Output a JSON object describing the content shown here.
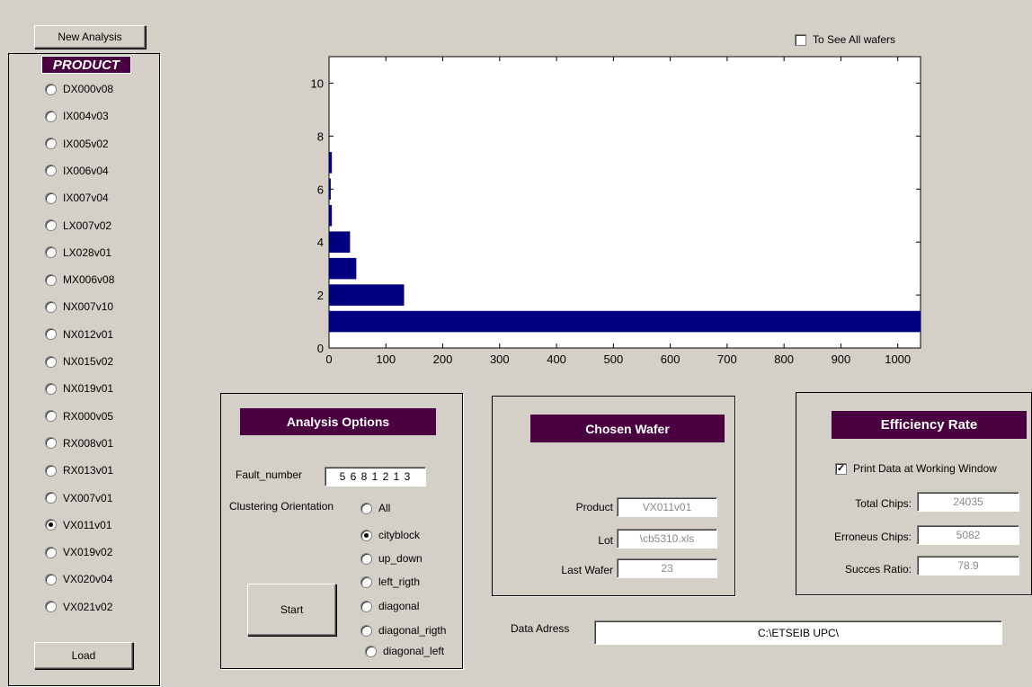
{
  "buttons": {
    "new_analysis": "New Analysis",
    "load": "Load",
    "start": "Start"
  },
  "product": {
    "title": "PRODUCT",
    "items": [
      {
        "label": "DX000v08",
        "selected": false
      },
      {
        "label": "IX004v03",
        "selected": false
      },
      {
        "label": "IX005v02",
        "selected": false
      },
      {
        "label": "IX006v04",
        "selected": false
      },
      {
        "label": "IX007v04",
        "selected": false
      },
      {
        "label": "LX007v02",
        "selected": false
      },
      {
        "label": "LX028v01",
        "selected": false
      },
      {
        "label": "MX006v08",
        "selected": false
      },
      {
        "label": "NX007v10",
        "selected": false
      },
      {
        "label": "NX012v01",
        "selected": false
      },
      {
        "label": "NX015v02",
        "selected": false
      },
      {
        "label": "NX019v01",
        "selected": false
      },
      {
        "label": "RX000v05",
        "selected": false
      },
      {
        "label": "RX008v01",
        "selected": false
      },
      {
        "label": "RX013v01",
        "selected": false
      },
      {
        "label": "VX007v01",
        "selected": false
      },
      {
        "label": "VX011v01",
        "selected": true
      },
      {
        "label": "VX019v02",
        "selected": false
      },
      {
        "label": "VX020v04",
        "selected": false
      },
      {
        "label": "VX021v02",
        "selected": false
      }
    ]
  },
  "see_all": {
    "label": "To See All wafers",
    "checked": false
  },
  "analysis": {
    "title": "Analysis Options",
    "fault_label": "Fault_number",
    "fault_value": "5 6 8 1 2 1 3",
    "clustering_label": "Clustering Orientation",
    "options": [
      {
        "label": "All",
        "selected": false
      },
      {
        "label": "cityblock",
        "selected": true
      },
      {
        "label": "up_down",
        "selected": false
      },
      {
        "label": "left_rigth",
        "selected": false
      },
      {
        "label": "diagonal",
        "selected": false
      },
      {
        "label": "diagonal_rigth",
        "selected": false
      },
      {
        "label": "diagonal_left",
        "selected": false
      }
    ]
  },
  "chosen_wafer": {
    "title": "Chosen Wafer",
    "product_label": "Product",
    "product_value": "VX011v01",
    "lot_label": "Lot",
    "lot_value": "\\cb5310.xls",
    "last_wafer_label": "Last Wafer",
    "last_wafer_value": "23"
  },
  "efficiency": {
    "title": "Efficiency Rate",
    "print_label": "Print Data at Working Window",
    "print_checked": true,
    "total_label": "Total Chips:",
    "total_value": "24035",
    "erroneus_label": "Erroneus Chips:",
    "erroneus_value": "5082",
    "succes_label": "Succes Ratio:",
    "succes_value": "78.9"
  },
  "data_address": {
    "label": "Data Adress",
    "value": "C:\\ETSEIB UPC\\"
  },
  "colors": {
    "bar": "#000080",
    "title_bg": "#4a0040",
    "panel": "#d4d0c8"
  },
  "chart_data": {
    "type": "bar",
    "orientation": "horizontal",
    "y": [
      1,
      2,
      3,
      4,
      5,
      6,
      7
    ],
    "values": [
      1040,
      132,
      48,
      37,
      5,
      3,
      5
    ],
    "xlim": [
      0,
      1040
    ],
    "ylim": [
      0,
      11
    ],
    "xticks": [
      0,
      100,
      200,
      300,
      400,
      500,
      600,
      700,
      800,
      900,
      1000
    ],
    "yticks": [
      0,
      2,
      4,
      6,
      8,
      10
    ]
  }
}
